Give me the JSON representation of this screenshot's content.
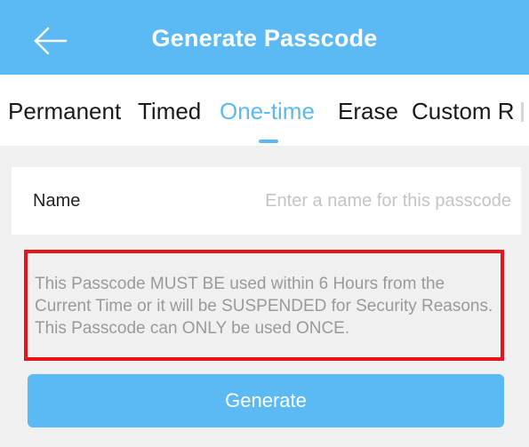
{
  "header": {
    "title": "Generate Passcode",
    "back_icon": "arrow-left-icon"
  },
  "tabs": [
    {
      "label": "Permanent",
      "active": false
    },
    {
      "label": "Timed",
      "active": false
    },
    {
      "label": "One-time",
      "active": true
    },
    {
      "label": "Erase",
      "active": false
    },
    {
      "label": "Custom R",
      "active": false
    }
  ],
  "form": {
    "name_label": "Name",
    "name_value": "",
    "name_placeholder": "Enter a name for this passcode"
  },
  "notice": {
    "text": "This Passcode MUST BE used within 6 Hours from the Current Time or it will be SUSPENDED for Security Reasons. This Passcode can ONLY be used ONCE."
  },
  "actions": {
    "generate_label": "Generate"
  },
  "colors": {
    "accent": "#5BB9F3",
    "highlight_border": "#E8141B",
    "background": "#F0F0F0"
  }
}
